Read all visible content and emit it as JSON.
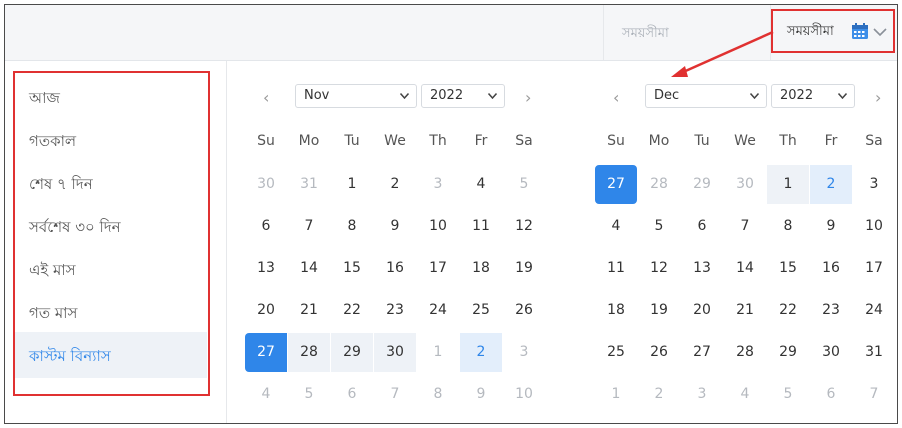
{
  "topbar": {
    "input_placeholder": "সময়সীমা",
    "trigger_label": "সময়সীমা",
    "accent": "#e03131"
  },
  "ranges": [
    {
      "label": "আজ",
      "active": false
    },
    {
      "label": "গতকাল",
      "active": false
    },
    {
      "label": "শেষ ৭ দিন",
      "active": false
    },
    {
      "label": "সর্বশেষ ৩০ দিন",
      "active": false
    },
    {
      "label": "এই মাস",
      "active": false
    },
    {
      "label": "গত মাস",
      "active": false
    },
    {
      "label": "কাস্টম বিন্যাস",
      "active": true
    }
  ],
  "weekdays": [
    "Su",
    "Mo",
    "Tu",
    "We",
    "Th",
    "Fr",
    "Sa"
  ],
  "calendars": [
    {
      "month": "Nov",
      "year": "2022",
      "prev": "‹",
      "next": "›",
      "rows": [
        [
          {
            "d": "30",
            "s": "muted"
          },
          {
            "d": "31",
            "s": "muted"
          },
          {
            "d": "1",
            "s": ""
          },
          {
            "d": "2",
            "s": ""
          },
          {
            "d": "3",
            "s": "muted"
          },
          {
            "d": "4",
            "s": ""
          },
          {
            "d": "5",
            "s": "muted"
          }
        ],
        [
          {
            "d": "6",
            "s": ""
          },
          {
            "d": "7",
            "s": ""
          },
          {
            "d": "8",
            "s": ""
          },
          {
            "d": "9",
            "s": ""
          },
          {
            "d": "10",
            "s": ""
          },
          {
            "d": "11",
            "s": ""
          },
          {
            "d": "12",
            "s": ""
          }
        ],
        [
          {
            "d": "13",
            "s": ""
          },
          {
            "d": "14",
            "s": ""
          },
          {
            "d": "15",
            "s": ""
          },
          {
            "d": "16",
            "s": ""
          },
          {
            "d": "17",
            "s": ""
          },
          {
            "d": "18",
            "s": ""
          },
          {
            "d": "19",
            "s": ""
          }
        ],
        [
          {
            "d": "20",
            "s": ""
          },
          {
            "d": "21",
            "s": ""
          },
          {
            "d": "22",
            "s": ""
          },
          {
            "d": "23",
            "s": ""
          },
          {
            "d": "24",
            "s": ""
          },
          {
            "d": "25",
            "s": ""
          },
          {
            "d": "26",
            "s": ""
          }
        ],
        [
          {
            "d": "27",
            "s": "start"
          },
          {
            "d": "28",
            "s": "inrange"
          },
          {
            "d": "29",
            "s": "inrange"
          },
          {
            "d": "30",
            "s": "inrange"
          },
          {
            "d": "1",
            "s": "muted"
          },
          {
            "d": "2",
            "s": "today"
          },
          {
            "d": "3",
            "s": "muted"
          }
        ],
        [
          {
            "d": "4",
            "s": "muted"
          },
          {
            "d": "5",
            "s": "muted"
          },
          {
            "d": "6",
            "s": "muted"
          },
          {
            "d": "7",
            "s": "muted"
          },
          {
            "d": "8",
            "s": "muted"
          },
          {
            "d": "9",
            "s": "muted"
          },
          {
            "d": "10",
            "s": "muted"
          }
        ]
      ]
    },
    {
      "month": "Dec",
      "year": "2022",
      "prev": "‹",
      "next": "›",
      "rows": [
        [
          {
            "d": "27",
            "s": "start-solo"
          },
          {
            "d": "28",
            "s": "muted"
          },
          {
            "d": "29",
            "s": "muted"
          },
          {
            "d": "30",
            "s": "muted"
          },
          {
            "d": "1",
            "s": "inrange"
          },
          {
            "d": "2",
            "s": "today"
          },
          {
            "d": "3",
            "s": ""
          }
        ],
        [
          {
            "d": "4",
            "s": ""
          },
          {
            "d": "5",
            "s": ""
          },
          {
            "d": "6",
            "s": ""
          },
          {
            "d": "7",
            "s": ""
          },
          {
            "d": "8",
            "s": ""
          },
          {
            "d": "9",
            "s": ""
          },
          {
            "d": "10",
            "s": ""
          }
        ],
        [
          {
            "d": "11",
            "s": ""
          },
          {
            "d": "12",
            "s": ""
          },
          {
            "d": "13",
            "s": ""
          },
          {
            "d": "14",
            "s": ""
          },
          {
            "d": "15",
            "s": ""
          },
          {
            "d": "16",
            "s": ""
          },
          {
            "d": "17",
            "s": ""
          }
        ],
        [
          {
            "d": "18",
            "s": ""
          },
          {
            "d": "19",
            "s": ""
          },
          {
            "d": "20",
            "s": ""
          },
          {
            "d": "21",
            "s": ""
          },
          {
            "d": "22",
            "s": ""
          },
          {
            "d": "23",
            "s": ""
          },
          {
            "d": "24",
            "s": ""
          }
        ],
        [
          {
            "d": "25",
            "s": ""
          },
          {
            "d": "26",
            "s": ""
          },
          {
            "d": "27",
            "s": ""
          },
          {
            "d": "28",
            "s": ""
          },
          {
            "d": "29",
            "s": ""
          },
          {
            "d": "30",
            "s": ""
          },
          {
            "d": "31",
            "s": ""
          }
        ],
        [
          {
            "d": "1",
            "s": "muted"
          },
          {
            "d": "2",
            "s": "muted"
          },
          {
            "d": "3",
            "s": "muted"
          },
          {
            "d": "4",
            "s": "muted"
          },
          {
            "d": "5",
            "s": "muted"
          },
          {
            "d": "6",
            "s": "muted"
          },
          {
            "d": "7",
            "s": "muted"
          }
        ]
      ]
    }
  ]
}
